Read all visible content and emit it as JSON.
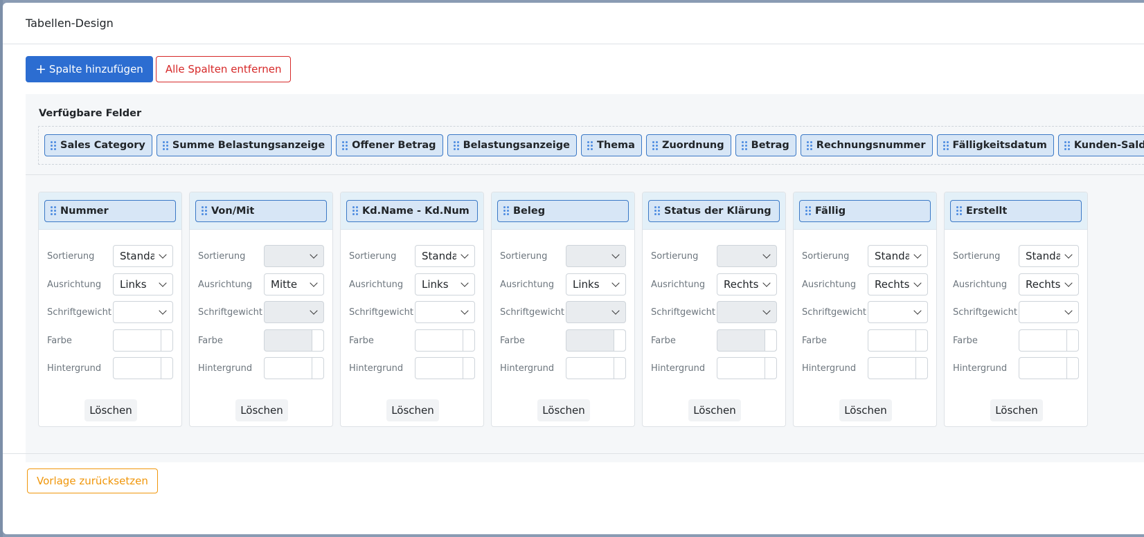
{
  "modal": {
    "title": "Tabellen-Design",
    "toolbar": {
      "add_column": "Spalte hinzufügen",
      "remove_all": "Alle Spalten entfernen"
    },
    "available_fields": {
      "title": "Verfügbare Felder",
      "items": [
        "Sales Category",
        "Summe Belastungsanzeige",
        "Offener Betrag",
        "Belastungsanzeige",
        "Thema",
        "Zuordnung",
        "Betrag",
        "Rechnungsnummer",
        "Fälligkeitsdatum",
        "Kunden-Saldo"
      ]
    },
    "labels": {
      "sort": "Sortierung",
      "align": "Ausrichtung",
      "weight": "Schriftgewicht",
      "color": "Farbe",
      "background": "Hintergrund",
      "delete": "Löschen"
    },
    "columns": [
      {
        "name": "Nummer",
        "sort": "Standard",
        "align": "Links",
        "weight": ""
      },
      {
        "name": "Von/Mit",
        "sort": "",
        "align": "Mitte",
        "weight": ""
      },
      {
        "name": "Kd.Name - Kd.Num",
        "sort": "Standard",
        "align": "Links",
        "weight": ""
      },
      {
        "name": "Beleg",
        "sort": "",
        "align": "Links",
        "weight": ""
      },
      {
        "name": "Status der Klärung",
        "sort": "",
        "align": "Rechts",
        "weight": ""
      },
      {
        "name": "Fällig",
        "sort": "Standard",
        "align": "Rechts",
        "weight": ""
      },
      {
        "name": "Erstellt",
        "sort": "Standard",
        "align": "Rechts",
        "weight": ""
      }
    ],
    "footer": {
      "reset": "Vorlage zurücksetzen"
    },
    "colors": {
      "primary": "#2c6dd1",
      "danger": "#d62828",
      "warning": "#f0960a",
      "chip_bg": "#d7e6f6",
      "chip_border": "#3a78c6"
    }
  }
}
